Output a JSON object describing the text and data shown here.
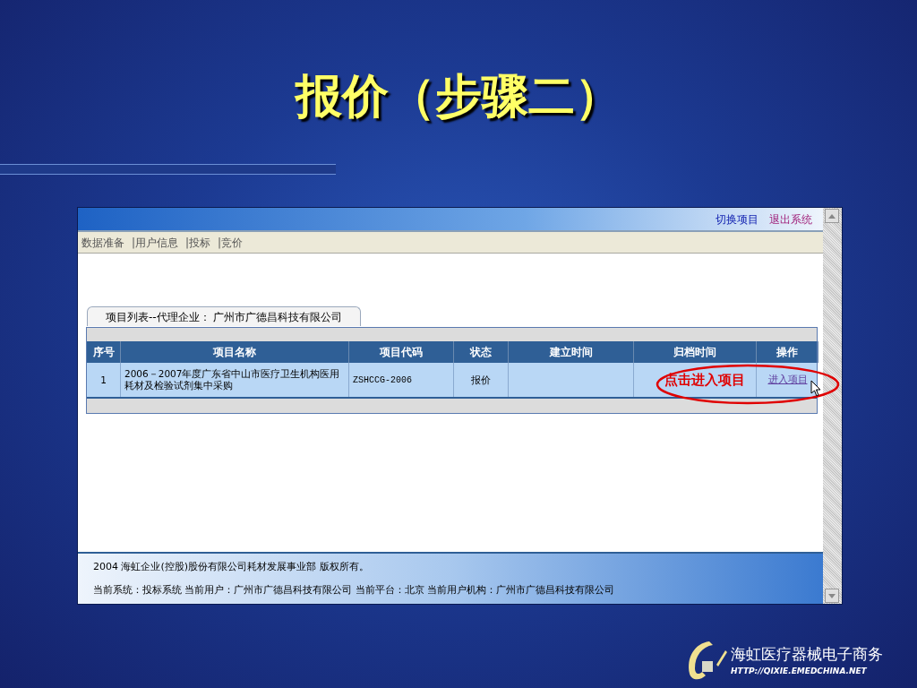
{
  "slide": {
    "title": "报价（步骤二）"
  },
  "browser": {
    "header_links": [
      {
        "label": "切换项目",
        "visited": false
      },
      {
        "label": "退出系统",
        "visited": true
      }
    ],
    "nav_items": [
      "数据准备",
      "|用户信息",
      "|投标",
      "|竞价"
    ],
    "tab": {
      "label": "项目列表--代理企业： 广州市广德昌科技有限公司"
    },
    "table": {
      "columns": [
        "序号",
        "项目名称",
        "项目代码",
        "状态",
        "建立时间",
        "归档时间",
        "操作"
      ],
      "rows": [
        {
          "cells": [
            "1",
            "2006－2007年度广东省中山市医疗卫生机构医用耗材及检验试剂集中采购",
            "ZSHCCG-2006",
            "报价",
            "",
            ""
          ],
          "action": "进入项目"
        }
      ]
    },
    "annotation": "点击进入项目",
    "footer": [
      "2004 海虹企业(控股)股份有限公司耗材发展事业部 版权所有。",
      "当前系统：投标系统 当前用户：广州市广德昌科技有限公司 当前平台：北京 当前用户机构：广州市广德昌科技有限公司"
    ]
  },
  "logo": {
    "name": "海虹医疗器械电子商务",
    "url": "HTTP://QIXIE.EMEDCHINA.NET"
  }
}
